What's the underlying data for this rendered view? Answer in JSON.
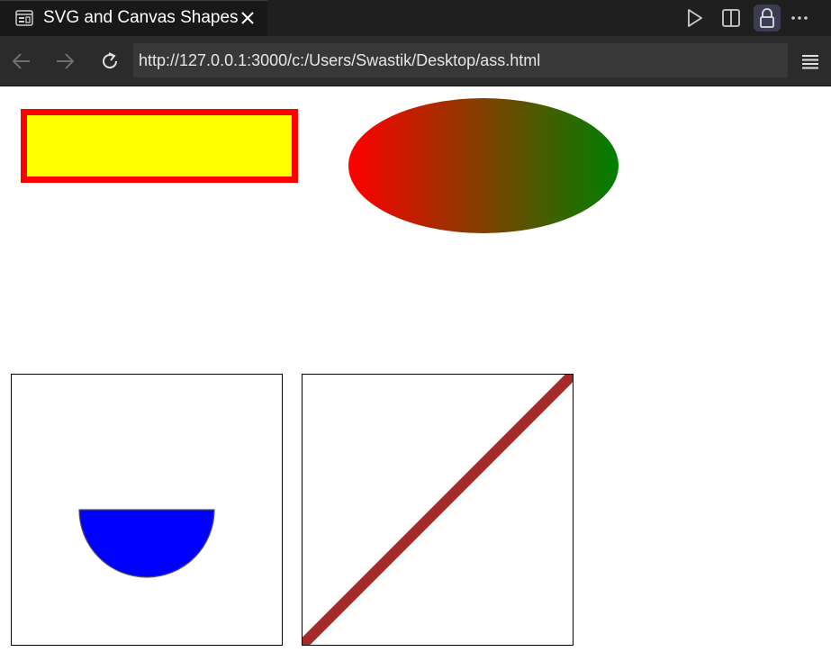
{
  "tab": {
    "title": "SVG and Canvas Shapes",
    "icon": "preview-icon",
    "close_icon": "close-icon"
  },
  "toolbar": {
    "run_icon": "play-icon",
    "split_icon": "split-editor-icon",
    "lock_icon": "lock-icon",
    "more_icon": "more-actions-icon"
  },
  "nav": {
    "back_icon": "back-arrow-icon",
    "forward_icon": "forward-arrow-icon",
    "reload_icon": "reload-icon",
    "url": "http://127.0.0.1:3000/c:/Users/Swastik/Desktop/ass.html",
    "menu_icon": "hamburger-menu-icon"
  },
  "shapes": {
    "rectangle": {
      "fill": "#ffff00",
      "stroke": "#ff0000"
    },
    "ellipse": {
      "gradient_start": "#ff0000",
      "gradient_end": "#008000"
    },
    "semicircle": {
      "fill": "#0000ff",
      "stroke": "#555555"
    },
    "diagonal_line": {
      "stroke": "#a52a2a"
    }
  },
  "colors": {
    "tabbar_bg": "#1f1f1f",
    "navbar_bg": "#2b2b2b",
    "url_bg": "#383838"
  }
}
